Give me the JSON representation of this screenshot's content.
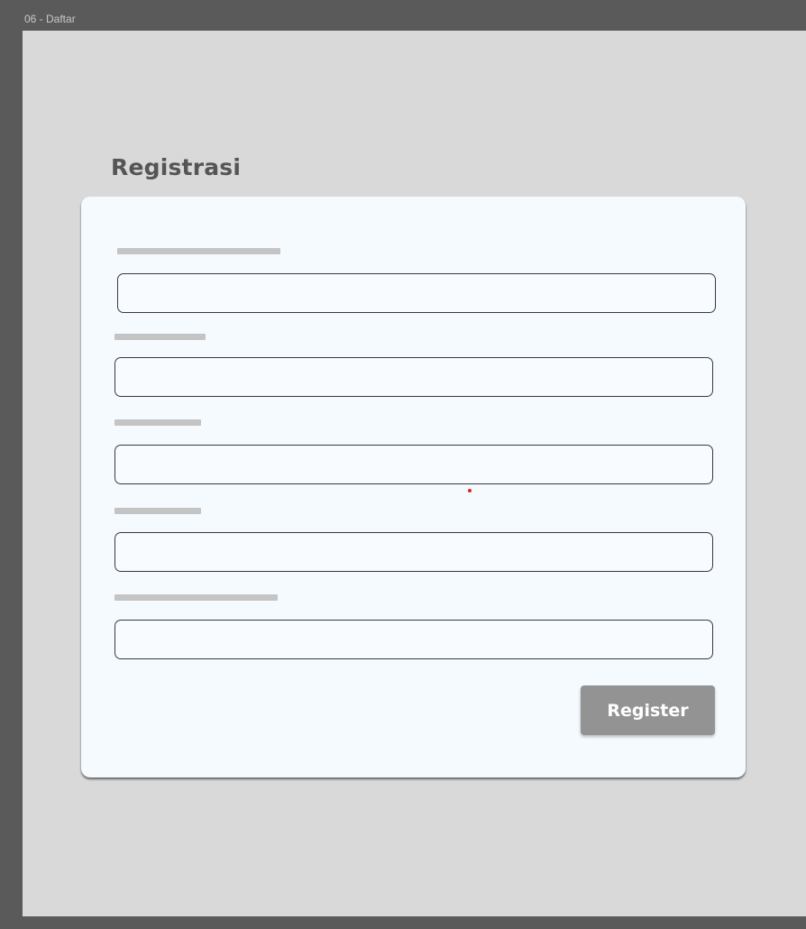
{
  "frame": {
    "label": "06 - Daftar"
  },
  "form": {
    "title": "Registrasi",
    "fields": [
      {
        "label": "",
        "value": ""
      },
      {
        "label": "",
        "value": ""
      },
      {
        "label": "",
        "value": ""
      },
      {
        "label": "",
        "value": ""
      },
      {
        "label": "",
        "value": ""
      }
    ],
    "submit_label": "Register"
  },
  "colors": {
    "canvas": "#5a5a5a",
    "frame_background": "#d9d9d9",
    "card_background": "#f5faff",
    "label_placeholder": "#c4c4c4",
    "button_background": "#939393",
    "title_text": "#555555"
  }
}
